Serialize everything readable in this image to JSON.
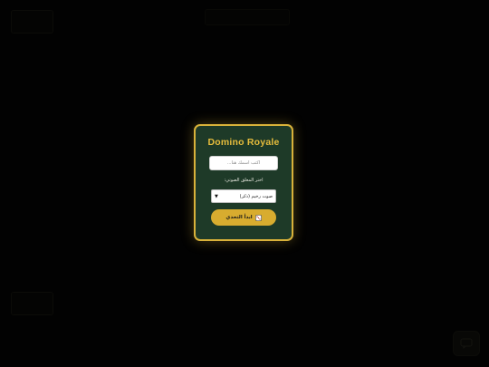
{
  "dialog": {
    "title": "Domino Royale",
    "name_placeholder": "اكتب اسمك هنا...",
    "voice_label": "اختر المعلق الصوتي:",
    "voice_selected": "صوت رخيم (ذكر)",
    "start_label": "ابدأ التحدي",
    "start_icon": "dice-icon"
  },
  "background": {
    "chat_icon": "chat-bubble-icon"
  },
  "colors": {
    "dialog_bg": "#1e3a28",
    "accent_gold": "#d9b23a",
    "page_bg": "#050505"
  }
}
